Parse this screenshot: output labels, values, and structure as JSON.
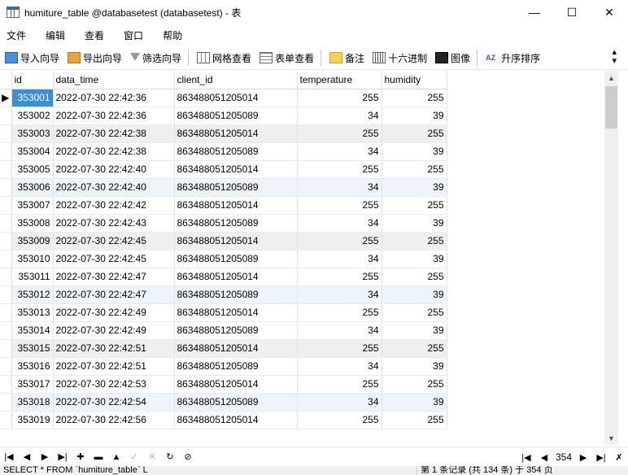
{
  "window": {
    "title": "humiture_table @databasetest (databasetest) - 表",
    "minimize": "—",
    "maximize": "☐",
    "close": "✕"
  },
  "menu": [
    "文件",
    "编辑",
    "查看",
    "窗口",
    "帮助"
  ],
  "toolbar": {
    "import_wizard": "导入向导",
    "export_wizard": "导出向导",
    "filter_wizard": "筛选向导",
    "grid_view": "网格查看",
    "form_view": "表单查看",
    "memo": "备注",
    "hex": "十六进制",
    "image": "图像",
    "sort_asc": "升序排序",
    "sort_icon_text": "AZ"
  },
  "columns": [
    "id",
    "data_time",
    "client_id",
    "temperature",
    "humidity"
  ],
  "rows": [
    [
      "353001",
      "2022-07-30 22:42:36",
      "863488051205014",
      "255",
      "255"
    ],
    [
      "353002",
      "2022-07-30 22:42:36",
      "863488051205089",
      "34",
      "39"
    ],
    [
      "353003",
      "2022-07-30 22:42:38",
      "863488051205014",
      "255",
      "255"
    ],
    [
      "353004",
      "2022-07-30 22:42:38",
      "863488051205089",
      "34",
      "39"
    ],
    [
      "353005",
      "2022-07-30 22:42:40",
      "863488051205014",
      "255",
      "255"
    ],
    [
      "353006",
      "2022-07-30 22:42:40",
      "863488051205089",
      "34",
      "39"
    ],
    [
      "353007",
      "2022-07-30 22:42:42",
      "863488051205014",
      "255",
      "255"
    ],
    [
      "353008",
      "2022-07-30 22:42:43",
      "863488051205089",
      "34",
      "39"
    ],
    [
      "353009",
      "2022-07-30 22:42:45",
      "863488051205014",
      "255",
      "255"
    ],
    [
      "353010",
      "2022-07-30 22:42:45",
      "863488051205089",
      "34",
      "39"
    ],
    [
      "353011",
      "2022-07-30 22:42:47",
      "863488051205014",
      "255",
      "255"
    ],
    [
      "353012",
      "2022-07-30 22:42:47",
      "863488051205089",
      "34",
      "39"
    ],
    [
      "353013",
      "2022-07-30 22:42:49",
      "863488051205014",
      "255",
      "255"
    ],
    [
      "353014",
      "2022-07-30 22:42:49",
      "863488051205089",
      "34",
      "39"
    ],
    [
      "353015",
      "2022-07-30 22:42:51",
      "863488051205014",
      "255",
      "255"
    ],
    [
      "353016",
      "2022-07-30 22:42:51",
      "863488051205089",
      "34",
      "39"
    ],
    [
      "353017",
      "2022-07-30 22:42:53",
      "863488051205014",
      "255",
      "255"
    ],
    [
      "353018",
      "2022-07-30 22:42:54",
      "863488051205089",
      "34",
      "39"
    ],
    [
      "353019",
      "2022-07-30 22:42:56",
      "863488051205014",
      "255",
      "255"
    ]
  ],
  "navigator": {
    "page": "354"
  },
  "status": {
    "sql": "SELECT * FROM `humiture_table` L",
    "record_info": "第 1 条记录 (共 134 条) 于 354 页"
  },
  "colors": {
    "selected_cell": "#3b8fd8",
    "alt_row": "#efefef",
    "highlight_row": "#eef4fb"
  }
}
